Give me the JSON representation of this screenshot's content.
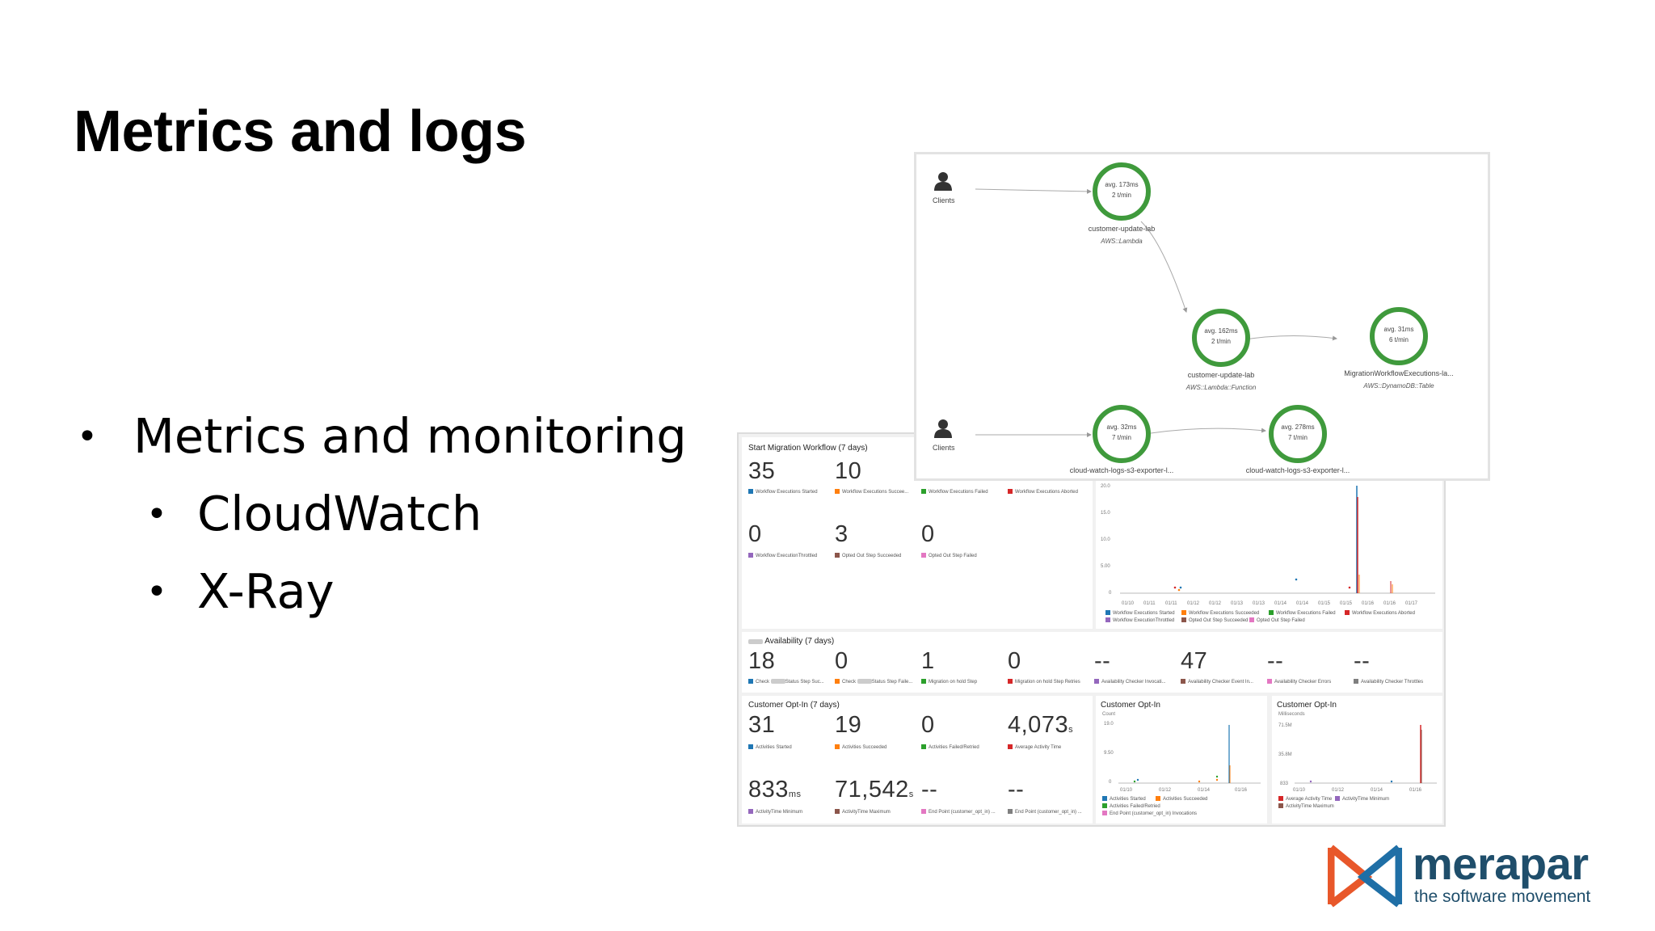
{
  "slide": {
    "title": "Metrics and logs",
    "bullets": {
      "level1": "Metrics and monitoring",
      "level2": [
        "CloudWatch",
        "X-Ray"
      ]
    }
  },
  "dashboard": {
    "start_migration": {
      "title": "Start Migration Workflow (7 days)",
      "row1": [
        {
          "value": "35",
          "label": "Workflow Executions Started",
          "color": "#1f77b4"
        },
        {
          "value": "10",
          "label": "Workflow Executions Succee...",
          "color": "#ff7f0e"
        },
        {
          "value": "",
          "label": "Workflow Executions Failed",
          "color": "#2ca02c"
        },
        {
          "value": "",
          "label": "Workflow Executions Aborted",
          "color": "#d62728"
        }
      ],
      "row2": [
        {
          "value": "0",
          "label": "Workflow ExecutionThrottled",
          "color": "#9467bd"
        },
        {
          "value": "3",
          "label": "Opted Out Step Succeeded",
          "color": "#8c564b"
        },
        {
          "value": "0",
          "label": "Opted Out Step Failed",
          "color": "#e377c2"
        }
      ]
    },
    "main_chart": {
      "y_ticks": [
        "20.0",
        "15.0",
        "10.0",
        "5.00",
        "0"
      ],
      "x_ticks": [
        "01/10",
        "01/11",
        "01/11",
        "01/12",
        "01/12",
        "01/13",
        "01/13",
        "01/14",
        "01/14",
        "01/15",
        "01/15",
        "01/16",
        "01/16",
        "01/17"
      ],
      "legend": [
        {
          "label": "Workflow Executions Started",
          "color": "#1f77b4"
        },
        {
          "label": "Workflow Executions Succeeded",
          "color": "#ff7f0e"
        },
        {
          "label": "Workflow Executions Failed",
          "color": "#2ca02c"
        },
        {
          "label": "Workflow Executions Aborted",
          "color": "#d62728"
        },
        {
          "label": "Workflow ExecutionThrottled",
          "color": "#9467bd"
        },
        {
          "label": "Opted Out Step Succeeded",
          "color": "#8c564b"
        },
        {
          "label": "Opted Out Step Failed",
          "color": "#e377c2"
        }
      ]
    },
    "availability": {
      "title": "Availability (7 days)",
      "items": [
        {
          "value": "18",
          "label_a": "Check",
          "label_b": "Status Step Suc...",
          "color": "#1f77b4"
        },
        {
          "value": "0",
          "label_a": "Check",
          "label_b": "Status Step Faile...",
          "color": "#ff7f0e"
        },
        {
          "value": "1",
          "label": "Migration on hold Step",
          "color": "#2ca02c"
        },
        {
          "value": "0",
          "label": "Migration on hold Step Retries",
          "color": "#d62728"
        },
        {
          "value": "--",
          "label": "Availability Checker Invocati...",
          "color": "#9467bd"
        },
        {
          "value": "47",
          "label": "Availability Checker Event In...",
          "color": "#8c564b"
        },
        {
          "value": "--",
          "label": "Availability Checker Errors",
          "color": "#e377c2"
        },
        {
          "value": "--",
          "label": "Availability Checker Throttles",
          "color": "#7f7f7f"
        }
      ]
    },
    "customer_optin_stats": {
      "title": "Customer Opt-In (7 days)",
      "row1": [
        {
          "value": "31",
          "unit": "",
          "label": "Activities Started",
          "color": "#1f77b4"
        },
        {
          "value": "19",
          "unit": "",
          "label": "Activities Succeeded",
          "color": "#ff7f0e"
        },
        {
          "value": "0",
          "unit": "",
          "label": "Activities Failed/Retried",
          "color": "#2ca02c"
        },
        {
          "value": "4,073",
          "unit": "s",
          "label": "Average Activity Time",
          "color": "#d62728"
        }
      ],
      "row2": [
        {
          "value": "833",
          "unit": "ms",
          "label": "ActivityTime Minimum",
          "color": "#9467bd"
        },
        {
          "value": "71,542",
          "unit": "s",
          "label": "ActivityTime Maximum",
          "color": "#8c564b"
        },
        {
          "value": "--",
          "unit": "",
          "label": "End Point (customer_opt_in) ...",
          "color": "#e377c2"
        },
        {
          "value": "--",
          "unit": "",
          "label": "End Point (customer_opt_in) ...",
          "color": "#7f7f7f"
        }
      ]
    },
    "customer_optin_count": {
      "title": "Customer Opt-In",
      "unit_label": "Count",
      "y_ticks": [
        "19.0",
        "9.50",
        "0"
      ],
      "x_ticks": [
        "01/10",
        "01/12",
        "01/14",
        "01/16"
      ],
      "legend": [
        {
          "label": "Activities Started",
          "color": "#1f77b4"
        },
        {
          "label": "Activities Succeeded",
          "color": "#ff7f0e"
        },
        {
          "label": "Activities Failed/Retried",
          "color": "#2ca02c"
        },
        {
          "label": "End Point (customer_opt_in) Invocations",
          "color": "#e377c2"
        }
      ]
    },
    "customer_optin_ms": {
      "title": "Customer Opt-In",
      "unit_label": "Milliseconds",
      "y_ticks": [
        "71.5M",
        "35.8M",
        "833"
      ],
      "x_ticks": [
        "01/10",
        "01/12",
        "01/14",
        "01/16"
      ],
      "legend": [
        {
          "label": "Average Activity Time",
          "color": "#d62728"
        },
        {
          "label": "ActivityTime Minimum",
          "color": "#9467bd"
        },
        {
          "label": "ActivityTime Maximum",
          "color": "#8c564b"
        }
      ]
    }
  },
  "service_map": {
    "clients_label": "Clients",
    "nodes": [
      {
        "avg": "avg. 173ms",
        "rate": "2 t/min",
        "name": "customer-update-lab",
        "type": "AWS::Lambda"
      },
      {
        "avg": "avg. 162ms",
        "rate": "2 t/min",
        "name": "customer-update-lab",
        "type": "AWS::Lambda::Function"
      },
      {
        "avg": "avg. 31ms",
        "rate": "6 t/min",
        "name": "MigrationWorkflowExecutions-la...",
        "type": "AWS::DynamoDB::Table"
      },
      {
        "avg": "avg. 32ms",
        "rate": "7 t/min",
        "name": "cloud-watch-logs-s3-exporter-l...",
        "type": ""
      },
      {
        "avg": "avg. 278ms",
        "rate": "7 t/min",
        "name": "cloud-watch-logs-s3-exporter-l...",
        "type": ""
      }
    ],
    "node_color": "#3f9a3c"
  },
  "brand": {
    "name": "merapar",
    "tagline": "the software movement",
    "colors": {
      "text": "#1f4e6b",
      "orange": "#e8572a",
      "blue": "#1f6fa6"
    }
  }
}
